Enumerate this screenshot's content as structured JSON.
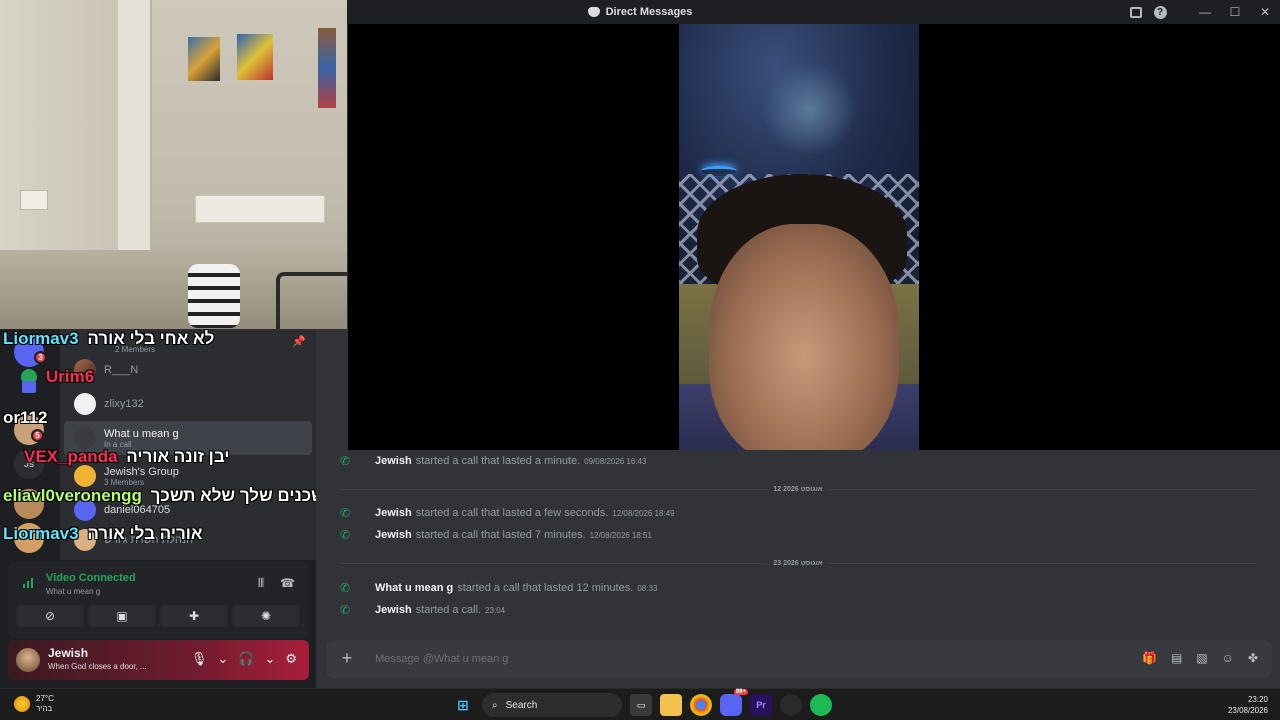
{
  "window": {
    "title": "Direct Messages"
  },
  "webcam": {},
  "dm_list": {
    "group_members": "2 Members",
    "items": [
      {
        "name": "R___N",
        "sub": ""
      },
      {
        "name": "zlixy132",
        "sub": ""
      },
      {
        "name": "What u mean g",
        "sub": "In a call",
        "active": true
      },
      {
        "name": "Jewish's Group",
        "sub": "3 Members"
      },
      {
        "name": "daniel064705",
        "sub": ""
      },
      {
        "name": "הנהלת השרת ג'וויש",
        "sub": ""
      }
    ]
  },
  "servers": {
    "badges": [
      "3",
      "5"
    ],
    "label": "Js"
  },
  "overlay_chat": [
    {
      "user": "Liormav3",
      "text": "לא אחי בלי אורה",
      "color": "#5ee6ff"
    },
    {
      "user": "Urim6",
      "text": "",
      "color": "#ff2d55"
    },
    {
      "user": "or112",
      "text": "",
      "color": "#ffffff"
    },
    {
      "user": "VEX_panda",
      "text": "יבן זונה אוריה",
      "color": "#ff2d55"
    },
    {
      "user": "eliavl0veronengg",
      "text": "אחי השכנים שלך שלא תשכך",
      "color": "#b4ff6a"
    },
    {
      "user": "Liormav3",
      "text": "אוריה בלי אורה",
      "color": "#5ee6ff"
    }
  ],
  "voice": {
    "status": "Video Connected",
    "channel": "What u mean g"
  },
  "user": {
    "name": "Jewish",
    "status": "When God closes a door, ..."
  },
  "messages": [
    {
      "author": "Jewish",
      "text": "started a call that lasted a minute.",
      "ts": "09/08/2026 16:43"
    },
    {
      "divider": "12 אוגוסט 2026"
    },
    {
      "author": "Jewish",
      "text": "started a call that lasted a few seconds.",
      "ts": "12/08/2026 18:49"
    },
    {
      "author": "Jewish",
      "text": "started a call that lasted 7 minutes.",
      "ts": "12/08/2026 18:51"
    },
    {
      "divider": "23 אוגוסט 2026"
    },
    {
      "author": "What u mean g",
      "text": "started a call that lasted 12 minutes.",
      "ts": "08:33"
    },
    {
      "author": "Jewish",
      "text": "started a call.",
      "ts": "23:04"
    }
  ],
  "composer": {
    "placeholder": "Message @What u mean g"
  },
  "taskbar": {
    "weather_temp": "27°C",
    "weather_desc": "בהיר",
    "search_label": "Search",
    "notif_badge": "99+",
    "time": "23:20",
    "date": "23/08/2026"
  },
  "colors": {
    "accent_green": "#23a55a",
    "discord_bg": "#313338",
    "sidebar_bg": "#2b2d31",
    "danger": "#f23f42"
  }
}
